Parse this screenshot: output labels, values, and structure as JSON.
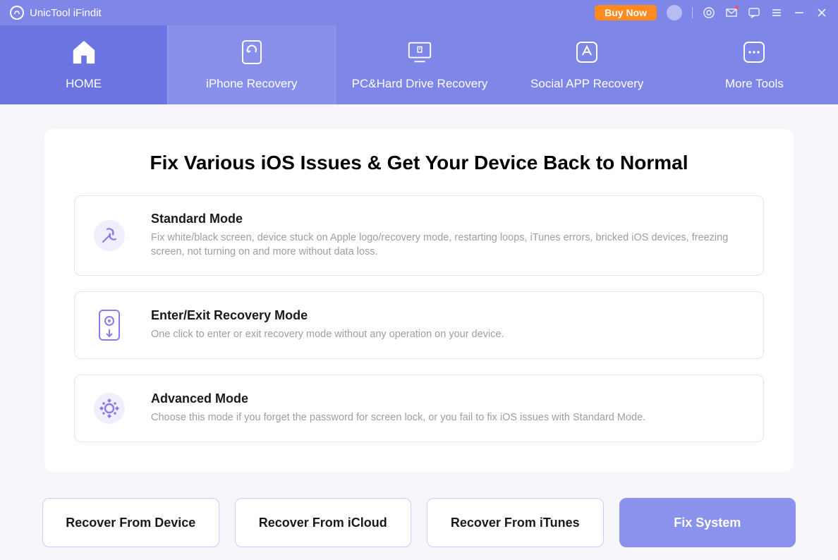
{
  "header": {
    "app_title": "UnicTool iFindit",
    "buy_now": "Buy Now"
  },
  "nav": {
    "tabs": [
      {
        "label": "HOME"
      },
      {
        "label": "iPhone Recovery"
      },
      {
        "label": "PC&Hard Drive Recovery"
      },
      {
        "label": "Social APP Recovery"
      },
      {
        "label": "More Tools"
      }
    ]
  },
  "main": {
    "title": "Fix Various iOS Issues & Get Your Device Back to Normal",
    "modes": [
      {
        "title": "Standard Mode",
        "desc": "Fix white/black screen, device stuck on Apple logo/recovery mode, restarting loops, iTunes errors, bricked iOS devices, freezing screen, not turning on and more without data loss."
      },
      {
        "title": "Enter/Exit Recovery Mode",
        "desc": "One click to enter or exit recovery mode without any operation on your device."
      },
      {
        "title": "Advanced Mode",
        "desc": "Choose this mode if you forget the password for screen lock, or you fail to fix iOS issues with Standard Mode."
      }
    ]
  },
  "actions": {
    "recover_device": "Recover From Device",
    "recover_icloud": "Recover From iCloud",
    "recover_itunes": "Recover From iTunes",
    "fix_system": "Fix System"
  }
}
